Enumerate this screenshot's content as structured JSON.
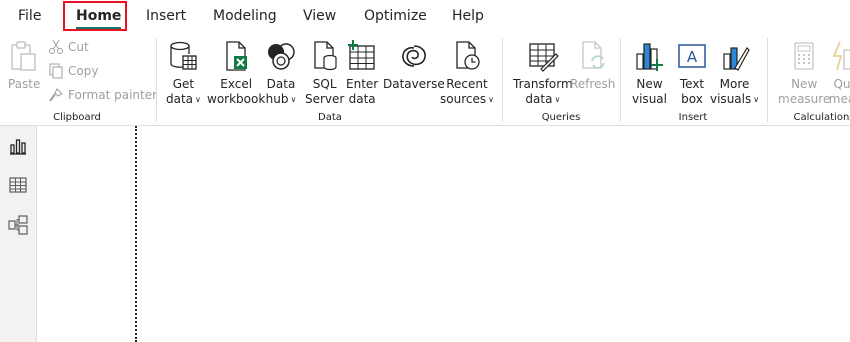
{
  "menu": {
    "tabs": [
      {
        "label": "File"
      },
      {
        "label": "Home"
      },
      {
        "label": "Insert"
      },
      {
        "label": "Modeling"
      },
      {
        "label": "View"
      },
      {
        "label": "Optimize"
      },
      {
        "label": "Help"
      }
    ],
    "active_tab": "Home"
  },
  "ribbon": {
    "clipboard": {
      "label": "Clipboard",
      "paste": "Paste",
      "cut": "Cut",
      "copy": "Copy",
      "format_painter": "Format painter"
    },
    "data": {
      "label": "Data",
      "get_data": [
        "Get",
        "data"
      ],
      "excel": [
        "Excel",
        "workbook"
      ],
      "data_hub": [
        "Data",
        "hub"
      ],
      "sql": [
        "SQL",
        "Server"
      ],
      "enter_data": [
        "Enter",
        "data"
      ],
      "dataverse": "Dataverse",
      "recent": [
        "Recent",
        "sources"
      ]
    },
    "queries": {
      "label": "Queries",
      "transform": [
        "Transform",
        "data"
      ],
      "refresh": "Refresh"
    },
    "insert": {
      "label": "Insert",
      "new_visual": [
        "New",
        "visual"
      ],
      "text_box": [
        "Text",
        "box"
      ],
      "more_visuals": [
        "More",
        "visuals"
      ]
    },
    "calculations": {
      "label": "Calculations",
      "new_measure": [
        "New",
        "measure"
      ],
      "quick_measure": [
        "Qu",
        "mea"
      ]
    }
  },
  "colors": {
    "accent": "#117865",
    "highlight": "#e81123",
    "disabled": "#a19f9d"
  }
}
